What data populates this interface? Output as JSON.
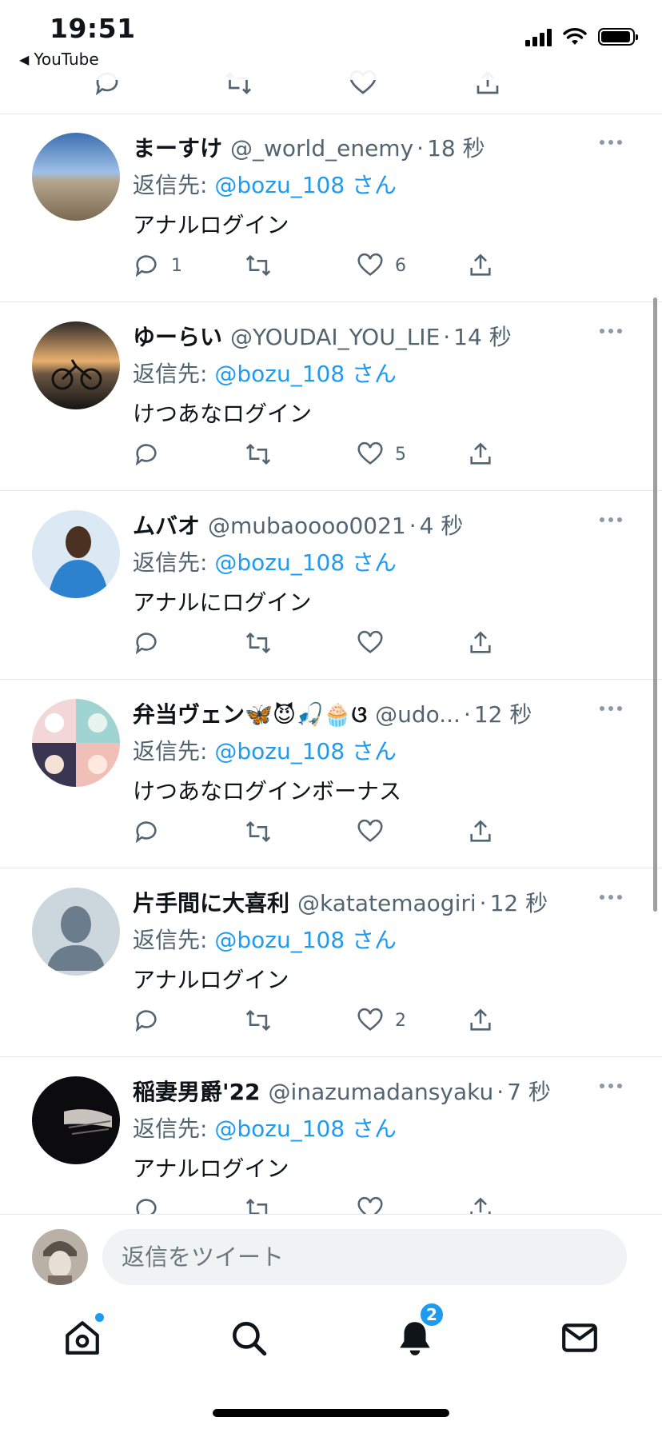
{
  "status_bar": {
    "time": "19:51",
    "back_app": "YouTube"
  },
  "tweets": [
    {
      "name": "まーすけ",
      "handle": "@_world_enemy",
      "time_ago": "18 秒",
      "reply_prefix": "返信先:",
      "reply_to": "@bozu_108 さん",
      "text": "アナルログイン",
      "reply_count": "1",
      "retweet_count": "",
      "like_count": "6"
    },
    {
      "name": "ゆーらい",
      "handle": "@YOUDAI_YOU_LIE",
      "time_ago": "14 秒",
      "reply_prefix": "返信先:",
      "reply_to": "@bozu_108 さん",
      "text": "けつあなログイン",
      "reply_count": "",
      "retweet_count": "",
      "like_count": "5"
    },
    {
      "name": "ムバオ",
      "handle": "@mubaoooo0021",
      "time_ago": "4 秒",
      "reply_prefix": "返信先:",
      "reply_to": "@bozu_108 さん",
      "text": "アナルにログイン",
      "reply_count": "",
      "retweet_count": "",
      "like_count": ""
    },
    {
      "name": "弁当ヴェン🦋😈🎣🧁ଓ",
      "handle": "@udo...",
      "time_ago": "12 秒",
      "reply_prefix": "返信先:",
      "reply_to": "@bozu_108 さん",
      "text": "けつあなログインボーナス",
      "reply_count": "",
      "retweet_count": "",
      "like_count": ""
    },
    {
      "name": "片手間に大喜利",
      "handle": "@katatemaogiri",
      "time_ago": "12 秒",
      "reply_prefix": "返信先:",
      "reply_to": "@bozu_108 さん",
      "text": "アナルログイン",
      "reply_count": "",
      "retweet_count": "",
      "like_count": "2"
    },
    {
      "name": "稲妻男爵'22",
      "handle": "@inazumadansyaku",
      "time_ago": "7 秒",
      "reply_prefix": "返信先:",
      "reply_to": "@bozu_108 さん",
      "text": "アナルログイン",
      "reply_count": "",
      "retweet_count": "",
      "like_count": ""
    }
  ],
  "reply_bar": {
    "placeholder": "返信をツイート"
  },
  "tab_bar": {
    "notifications_badge": "2"
  },
  "colors": {
    "accent": "#1d9bf0",
    "secondary_text": "#536471",
    "divider": "#e6e9ec"
  },
  "icons": [
    "reply-icon",
    "retweet-icon",
    "like-icon",
    "share-icon",
    "more-icon",
    "home-icon",
    "search-icon",
    "bell-icon",
    "mail-icon"
  ]
}
